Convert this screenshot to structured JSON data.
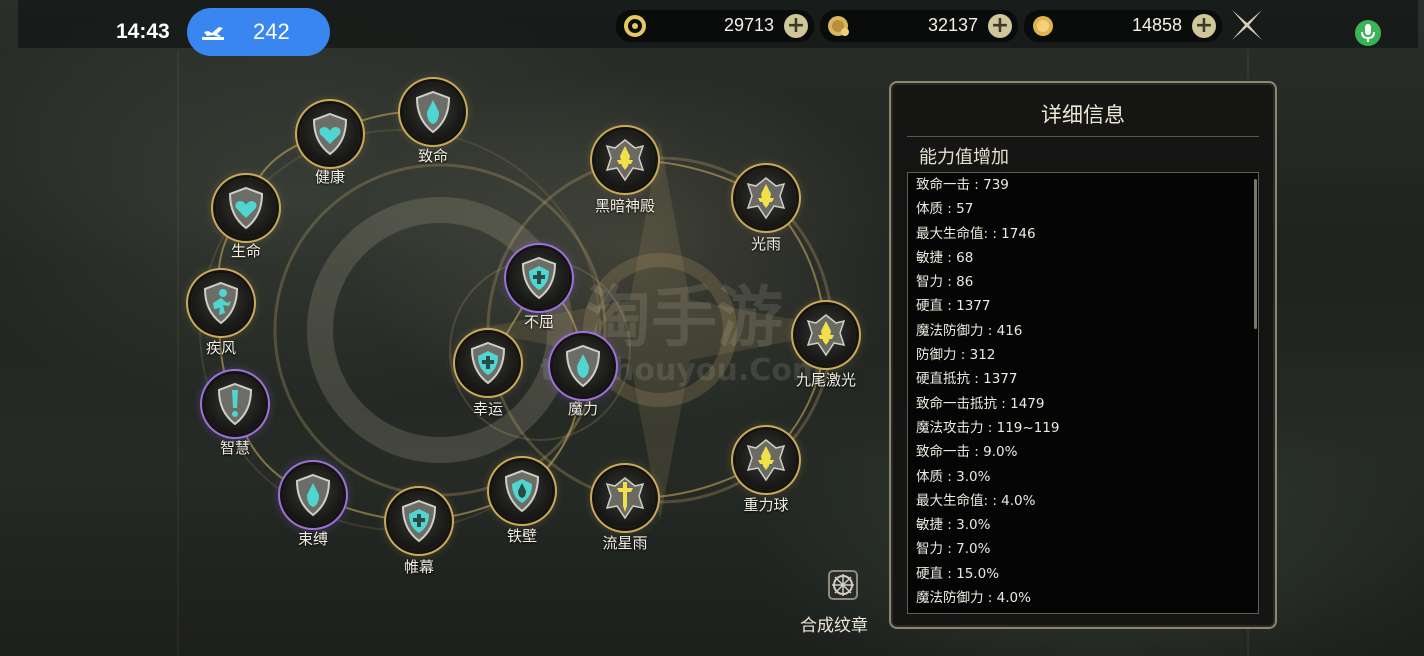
{
  "status": {
    "time": "14:43",
    "notification_count": "242"
  },
  "currencies": [
    {
      "icon": "ring-currency-icon",
      "value": "29713"
    },
    {
      "icon": "gold-coin-bag-icon",
      "value": "32137"
    },
    {
      "icon": "gold-coin-icon",
      "value": "14858"
    }
  ],
  "colors": {
    "accent": "#c9a95a",
    "purple_ring": "#9a72d8",
    "teal_emblem": "#4fd6d0",
    "yellow_emblem": "#f1e04a",
    "pill": "#3a86f0",
    "mic": "#3bb356"
  },
  "nodes": [
    {
      "id": "jiankang",
      "label": "健康",
      "ring": "gold",
      "emblem": "teal-heart"
    },
    {
      "id": "zhiming",
      "label": "致命",
      "ring": "gold",
      "emblem": "teal-drop"
    },
    {
      "id": "shengming",
      "label": "生命",
      "ring": "gold",
      "emblem": "teal-heart"
    },
    {
      "id": "jifeng",
      "label": "疾风",
      "ring": "gold",
      "emblem": "teal-runner"
    },
    {
      "id": "zhihui",
      "label": "智慧",
      "ring": "purple",
      "emblem": "teal-exclaim"
    },
    {
      "id": "shufu",
      "label": "束缚",
      "ring": "purple",
      "emblem": "teal-drop"
    },
    {
      "id": "weimu",
      "label": "帷幕",
      "ring": "gold",
      "emblem": "teal-cross"
    },
    {
      "id": "tiebi",
      "label": "铁壁",
      "ring": "gold",
      "emblem": "teal-drop"
    },
    {
      "id": "buqu",
      "label": "不屈",
      "ring": "purple",
      "emblem": "teal-cross"
    },
    {
      "id": "xingyun",
      "label": "幸运",
      "ring": "gold",
      "emblem": "teal-cross"
    },
    {
      "id": "moli",
      "label": "魔力",
      "ring": "purple",
      "emblem": "teal-drop"
    },
    {
      "id": "heianshendian",
      "label": "黑暗神殿",
      "ring": "gold",
      "emblem": "yellow-crystal"
    },
    {
      "id": "guangyu",
      "label": "光雨",
      "ring": "gold",
      "emblem": "yellow-crystal"
    },
    {
      "id": "jiuweijiguang",
      "label": "九尾激光",
      "ring": "gold",
      "emblem": "yellow-crystal"
    },
    {
      "id": "zhongliqiu",
      "label": "重力球",
      "ring": "gold",
      "emblem": "yellow-crystal"
    },
    {
      "id": "liuxingyu",
      "label": "流星雨",
      "ring": "gold",
      "emblem": "yellow-sword"
    }
  ],
  "detail": {
    "title": "详细信息",
    "subtitle": "能力值增加",
    "stats": [
      "致命一击 : 739",
      "体质 : 57",
      "最大生命值:   : 1746",
      "敏捷 : 68",
      "智力 : 86",
      "硬直 : 1377",
      "魔法防御力 : 416",
      "防御力 : 312",
      "硬直抵抗 : 1377",
      "致命一击抵抗 : 1479",
      "魔法攻击力 : 119~119",
      "致命一击 : 9.0%",
      "体质 : 3.0%",
      "最大生命值:   : 4.0%",
      "敏捷 : 3.0%",
      "智力 : 7.0%",
      "硬直 : 15.0%",
      "魔法防御力 : 4.0%"
    ]
  },
  "synthesize": {
    "label": "合成纹章",
    "icon": "emblem-synthesize-icon"
  }
}
